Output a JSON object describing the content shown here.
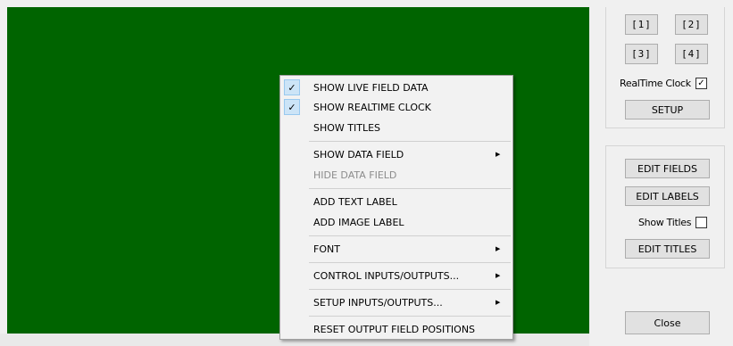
{
  "app_window": {
    "quick_buttons": [
      "[1]",
      "[2]",
      "[3]",
      "[4]"
    ],
    "realtime_clock": {
      "label": "RealTime Clock",
      "checked": true,
      "check_glyph": "✓"
    },
    "setup_label": "SETUP",
    "edit_fields_label": "EDIT FIELDS",
    "edit_labels_label": "EDIT LABELS",
    "show_titles": {
      "label": "Show Titles",
      "checked": false
    },
    "edit_titles_label": "EDIT TITLES",
    "close_label": "Close"
  },
  "context_menu": {
    "check_glyph": "✓",
    "arrow_glyph": "▶",
    "items": [
      {
        "label": "SHOW LIVE FIELD DATA",
        "checked": true,
        "submenu": false,
        "enabled": true
      },
      {
        "label": "SHOW REALTIME CLOCK",
        "checked": true,
        "submenu": false,
        "enabled": true
      },
      {
        "label": "SHOW TITLES",
        "checked": false,
        "submenu": false,
        "enabled": true
      },
      {
        "label": "SHOW DATA FIELD",
        "checked": false,
        "submenu": true,
        "enabled": true
      },
      {
        "label": "HIDE DATA FIELD",
        "checked": false,
        "submenu": false,
        "enabled": false
      },
      {
        "label": "ADD TEXT LABEL",
        "checked": false,
        "submenu": false,
        "enabled": true
      },
      {
        "label": "ADD IMAGE LABEL",
        "checked": false,
        "submenu": false,
        "enabled": true
      },
      {
        "label": "FONT",
        "checked": false,
        "submenu": true,
        "enabled": true
      },
      {
        "label": "CONTROL INPUTS/OUTPUTS...",
        "checked": false,
        "submenu": true,
        "enabled": true
      },
      {
        "label": "SETUP INPUTS/OUTPUTS...",
        "checked": false,
        "submenu": true,
        "enabled": true
      },
      {
        "label": "RESET OUTPUT FIELD POSITIONS",
        "checked": false,
        "submenu": false,
        "enabled": true
      }
    ]
  },
  "colors": {
    "canvas": "#006400",
    "menu_background": "#f2f2f2",
    "check_highlight": "#cce4f7",
    "disabled_text": "#8c8c8c"
  }
}
